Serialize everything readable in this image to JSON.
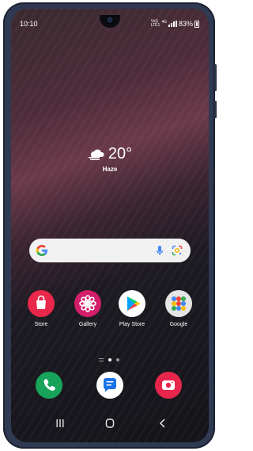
{
  "status_bar": {
    "time": "10:10",
    "network_top": "Vo))",
    "network_bottom": "LTE1",
    "network_type": "4G",
    "battery": "83%"
  },
  "weather": {
    "temperature": "20°",
    "condition": "Haze",
    "icon": "haze-cloud-icon"
  },
  "search": {
    "logo": "G",
    "icons": [
      "microphone-icon",
      "google-lens-icon"
    ]
  },
  "apps": [
    {
      "label": "Store",
      "icon": "galaxy-store-icon",
      "color": "#e8274b"
    },
    {
      "label": "Gallery",
      "icon": "gallery-flower-icon",
      "color": "#d31f6a"
    },
    {
      "label": "Play Store",
      "icon": "play-store-icon",
      "color": "#ffffff"
    },
    {
      "label": "Google",
      "icon": "google-folder-icon",
      "color": "#e5e5e5"
    }
  ],
  "page_indicator": {
    "pages": 2,
    "current": 1
  },
  "dock": [
    {
      "icon": "phone-icon",
      "color": "#17a45a"
    },
    {
      "icon": "messages-icon",
      "color": "#ffffff"
    },
    {
      "icon": "camera-icon",
      "color": "#e8264c"
    }
  ],
  "nav_bar": [
    "recents-icon",
    "home-icon",
    "back-icon"
  ]
}
